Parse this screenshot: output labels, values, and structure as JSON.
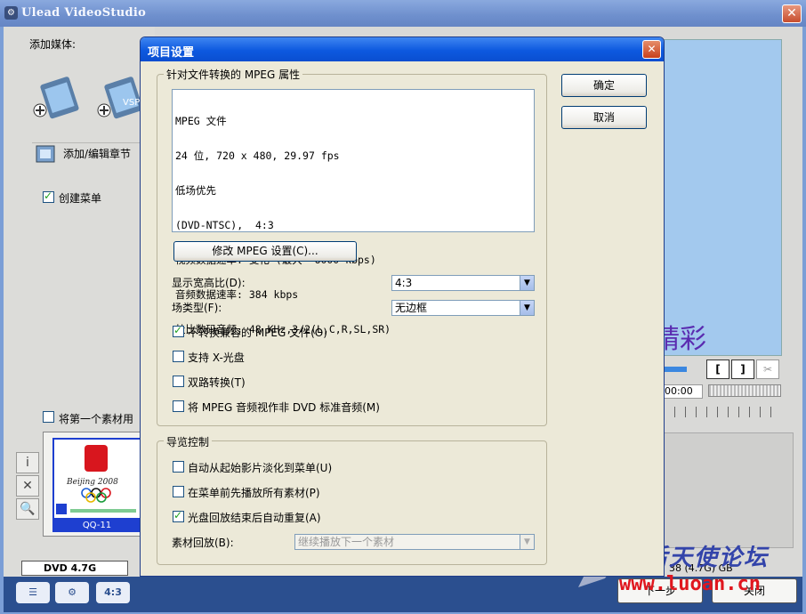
{
  "app": {
    "title": "Ulead VideoStudio",
    "close_label": "✕"
  },
  "left_panel": {
    "add_media_label": "添加媒体:",
    "media_icons": [
      "add-video-icon",
      "add-vsp-icon"
    ],
    "vsp_badge": "VSP",
    "chapter_label": "添加/编辑章节",
    "create_menu_label": "创建菜单",
    "create_menu_checked": true,
    "first_clip_label": "将第一个素材用",
    "first_clip_checked": false,
    "thumb_caption": "QQ-11",
    "thumb_beijing": "Beijing 2008",
    "side_buttons": [
      "i",
      "✕",
      "🔍"
    ],
    "disk_option": "DVD 4.7G"
  },
  "bottom_bar": {
    "icons": [
      "list-icon",
      "settings-icon",
      "aspect-icon"
    ],
    "aspect_label": "4:3",
    "prev_label": "下一步",
    "close_label": "关闭"
  },
  "preview": {
    "text": "精彩",
    "time": "00:00",
    "mark_in": "[",
    "mark_out": "]",
    "capacity": "38 (4.7G) GB"
  },
  "watermark": {
    "name": "落后天使论坛",
    "url": "www.luoan.cn"
  },
  "dialog": {
    "title": "项目设置",
    "close_label": "✕",
    "ok_label": "确定",
    "cancel_label": "取消",
    "mpeg_group_label": "针对文件转换的 MPEG 属性",
    "properties": [
      "MPEG 文件",
      "24 位, 720 x 480, 29.97 fps",
      "低场优先",
      "(DVD-NTSC),  4:3",
      "视频数据速率: 变化 (最大  6000 kbps)",
      "音频数据速率: 384 kbps",
      "杜比数码音频, 48 KHz,3/2(L,C,R,SL,SR)"
    ],
    "modify_button": "修改 MPEG 设置(C)...",
    "aspect_label": "显示宽高比(D):",
    "aspect_value": "4:3",
    "field_label": "场类型(F):",
    "field_value": "无边框",
    "options": [
      {
        "label": "不转换兼容的 MPEG 文件(O)",
        "checked": true
      },
      {
        "label": "支持 X-光盘",
        "checked": false
      },
      {
        "label": "双路转换(T)",
        "checked": false
      },
      {
        "label": "将 MPEG 音频视作非 DVD 标准音频(M)",
        "checked": false
      }
    ],
    "nav_group_label": "导览控制",
    "nav_options": [
      {
        "label": "自动从起始影片淡化到菜单(U)",
        "checked": false
      },
      {
        "label": "在菜单前先播放所有素材(P)",
        "checked": false
      },
      {
        "label": "光盘回放结束后自动重复(A)",
        "checked": true
      }
    ],
    "playback_label": "素材回放(B):",
    "playback_value": "继续播放下一个素材"
  }
}
